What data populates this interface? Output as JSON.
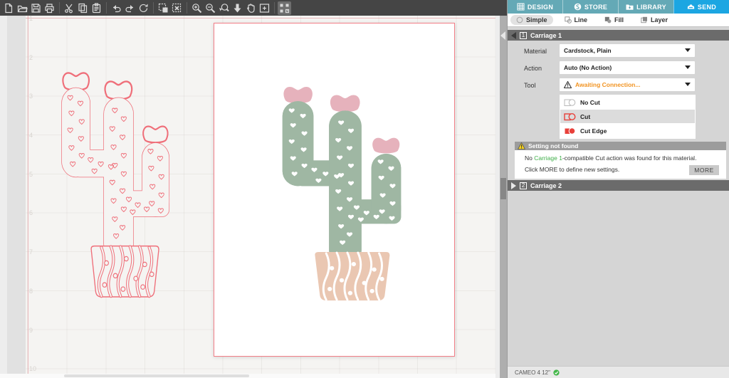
{
  "toolbar": {
    "icons": [
      "new-document",
      "open-file",
      "save",
      "print",
      "cut",
      "copy",
      "paste",
      "undo",
      "redo",
      "sync",
      "select-all",
      "deselect",
      "zoom-in",
      "zoom-out",
      "zoom-selection",
      "zoom-drag",
      "pan",
      "fit-to-page",
      "registration-marks"
    ]
  },
  "panel": {
    "tabs": [
      {
        "label": "DESIGN"
      },
      {
        "label": "STORE"
      },
      {
        "label": "LIBRARY"
      },
      {
        "label": "SEND",
        "active": true
      }
    ],
    "subtabs": [
      {
        "label": "Simple",
        "selected": true
      },
      {
        "label": "Line"
      },
      {
        "label": "Fill"
      },
      {
        "label": "Layer"
      }
    ],
    "carriage1": {
      "number": "1",
      "title": "Carriage 1",
      "material_label": "Material",
      "material_value": "Cardstock, Plain",
      "action_label": "Action",
      "action_value": "Auto (No Action)",
      "tool_label": "Tool",
      "tool_value": "Awaiting Connection..."
    },
    "cut_options": [
      {
        "label": "No Cut",
        "selected": false
      },
      {
        "label": "Cut",
        "selected": true
      },
      {
        "label": "Cut Edge",
        "selected": false
      }
    ],
    "warning": {
      "title": "Setting not found",
      "line1_pre": "No ",
      "line1_link": "Carriage 1",
      "line1_post": "-compatible Cut action was found for this material.",
      "line2": "Click MORE to define new settings.",
      "more_label": "MORE"
    },
    "carriage2": {
      "number": "2",
      "title": "Carriage 2"
    },
    "status": {
      "machine": "CAMEO 4 12\"",
      "connected": true
    }
  },
  "canvas": {
    "ruler_numbers": [
      "1",
      "2",
      "3",
      "4",
      "5",
      "6",
      "7",
      "8",
      "9",
      "10"
    ],
    "design": "heart-pattern cactus in wavy-striped pot, cut-line preview at left, filled artwork on page"
  },
  "colors": {
    "send_tab_blue": "#1ca6e2",
    "tab_teal": "#64a9b6",
    "cut_line_red": "#ef6e79",
    "cactus_green": "#9fb7a3",
    "flower_pink": "#e6b2bc",
    "pot_tan": "#eac7b2",
    "warning_orange": "#f29422",
    "carriage_link_green": "#3fae49",
    "connected_green": "#43b649"
  }
}
